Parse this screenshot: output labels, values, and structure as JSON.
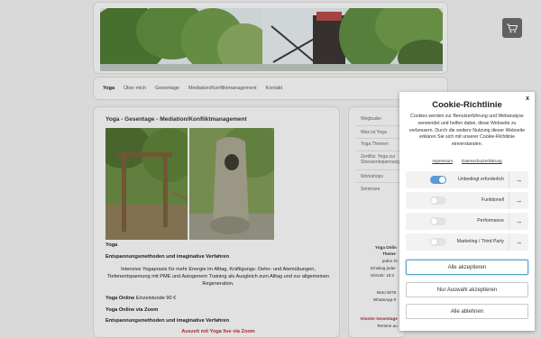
{
  "header": {
    "cart_icon": "shopping-cart-icon"
  },
  "nav": {
    "items": [
      "Yoga",
      "Über mich",
      "Gesentage",
      "Mediation/Konfliktmanagement",
      "Kontakt"
    ]
  },
  "main": {
    "title": "Yoga - Gesentage - Mediation/Konfliktmanagement",
    "heading_yoga": "Yoga",
    "subtitle1": "Entspannungsmethoden und imaginative Verfahren",
    "description": "Intensive Yogapraxis für mehr Energie im Alltag, Kräftigungs- Dehn- und Atemübungen, Tiefenentspannung mit PME und Autogenem Training als Ausgleich zum Alltag und zur allgemeinen Regeneration.",
    "online_price_bold": "Yoga Online",
    "online_price_rest": " Einzelstunde 90 €",
    "online_zoom": "Yoga Online via Zoom",
    "subtitle2": "Entspannungsmethoden und imaginative Verfahren",
    "red_line": "Auszeit mit Yoga live via Zoom"
  },
  "sidebar": {
    "items": [
      "Wegbuder",
      "Was ist Yoga",
      "Yoga Themen",
      "Zertifizi. Yoga zur Stressentspannung",
      "Workshops",
      "Seminare"
    ],
    "bottom_bold1": "Yoga Onlin",
    "bottom_bold2": "Theme",
    "bottom_lines": [
      "jeden Di",
      "Einstieg jeder",
      "Uhrzeit: 18:3"
    ],
    "bottom_lines2": [
      "Büro 0079",
      "WhatsApp-0"
    ],
    "bottom_bold3": "Kloster-Gesentage",
    "bottom_line3": "Termine au"
  },
  "cookie": {
    "close": "x",
    "title": "Cookie-Richtlinie",
    "description": "Cookies werden zur Benutzerführung und Webanalyse verwendet und helfen dabei, diese Webseite zu verbessern. Durch die weitere Nutzung dieser Webseite erklären Sie sich mit unserer Cookie-Richtlinie einverstanden.",
    "links": [
      "Impressum",
      "Datenschutzerklärung"
    ],
    "options": [
      {
        "label": "Unbedingt erforderlich",
        "on": true
      },
      {
        "label": "Funktionell",
        "on": false
      },
      {
        "label": "Performance",
        "on": false
      },
      {
        "label": "Marketing / Third Party",
        "on": false
      }
    ],
    "accept_all": "Alle akzeptieren",
    "accept_selection": "Nur Auswahl akzeptieren",
    "reject_all": "Alle ablehnen",
    "accent": "#5aa0c8"
  }
}
